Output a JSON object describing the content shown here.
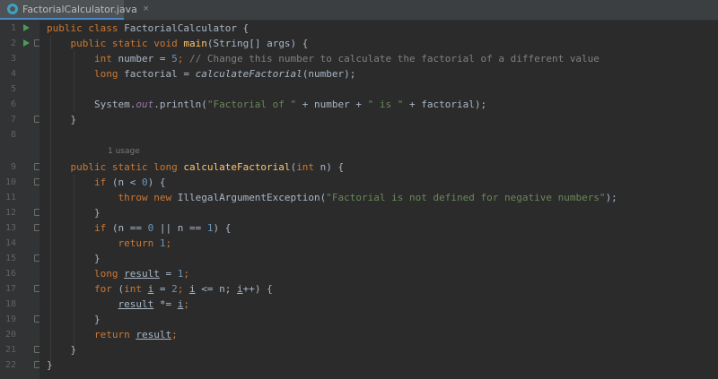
{
  "tab": {
    "filename": "FactorialCalculator.java",
    "close": "×"
  },
  "line_numbers": [
    "1",
    "2",
    "3",
    "4",
    "5",
    "6",
    "7",
    "8",
    "9",
    "10",
    "11",
    "12",
    "13",
    "14",
    "15",
    "16",
    "17",
    "18",
    "19",
    "20",
    "21",
    "22"
  ],
  "usage_hint": "1 usage",
  "code": {
    "l1": [
      "public class",
      "FactorialCalculator {"
    ],
    "l2": [
      "public static void",
      "main",
      "(String[] args) {"
    ],
    "l3": [
      "int",
      "number = ",
      "5",
      ";",
      "// Change this number to calculate the factorial of a different value"
    ],
    "l4": [
      "long",
      "factorial = ",
      "calculateFactorial",
      "(number);"
    ],
    "l6": [
      "System.",
      "out",
      ".println(",
      "\"Factorial of \"",
      " + number + ",
      "\" is \"",
      " + factorial);"
    ],
    "l7": [
      "}"
    ],
    "l9": [
      "public static long",
      "calculateFactorial",
      "(",
      "int",
      " n) {"
    ],
    "l10": [
      "if",
      " (n < ",
      "0",
      ") {"
    ],
    "l11": [
      "throw new",
      "IllegalArgumentException(",
      "\"Factorial is not defined for negative numbers\"",
      ");"
    ],
    "l12": [
      "}"
    ],
    "l13": [
      "if",
      " (n == ",
      "0",
      " || n == ",
      "1",
      ") {"
    ],
    "l14": [
      "return",
      "1",
      ";"
    ],
    "l15": [
      "}"
    ],
    "l16": [
      "long",
      "result",
      " = ",
      "1",
      ";"
    ],
    "l17": [
      "for",
      " (",
      "int",
      "i",
      " = ",
      "2",
      "; ",
      "i",
      " <= n; ",
      "i",
      "++) {"
    ],
    "l18": [
      "result",
      " *= ",
      "i",
      ";"
    ],
    "l19": [
      "}"
    ],
    "l20": [
      "return",
      "result",
      ";"
    ],
    "l21": [
      "}"
    ],
    "l22": [
      "}"
    ]
  }
}
